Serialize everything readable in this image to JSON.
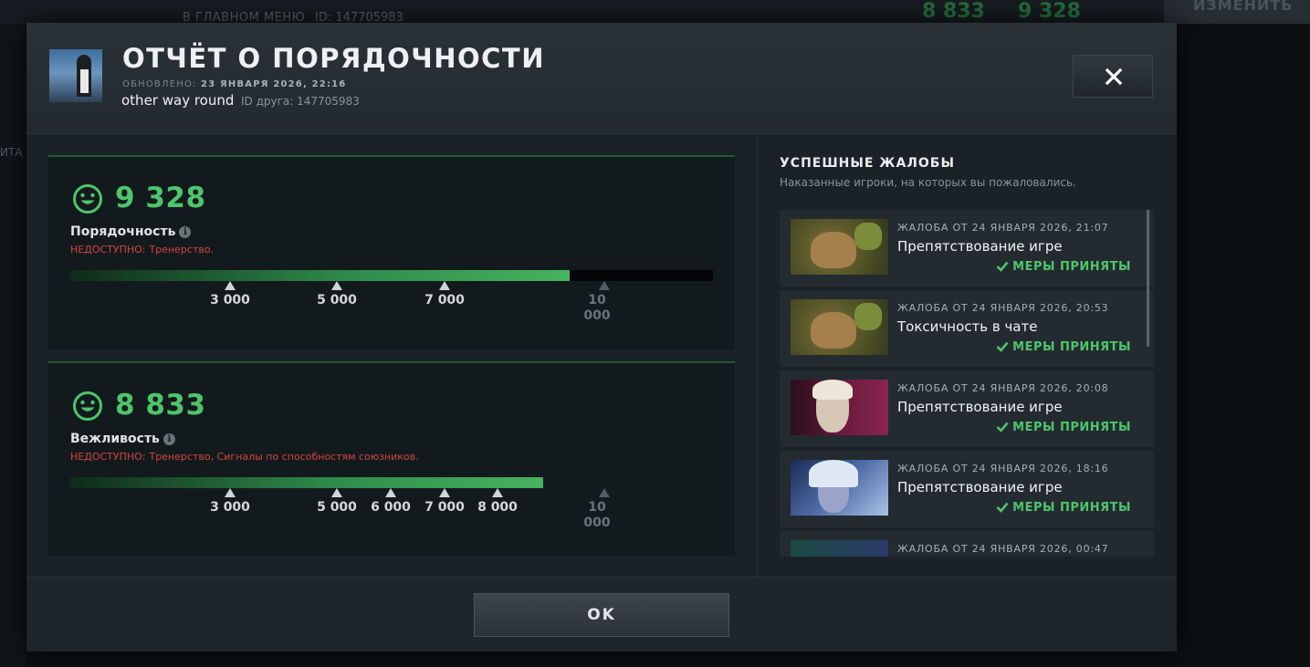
{
  "background": {
    "subtitle": "В ГЛАВНОМ МЕНЮ",
    "id_text": "ID: 147705983",
    "score_courtesy": "8 833",
    "score_conduct": "9 328",
    "change_label": "ИЗМЕНИТЬ",
    "side_label": "ИТА"
  },
  "header": {
    "title": "ОТЧЁТ О ПОРЯДОЧНОСТИ",
    "updated_label": "ОБНОВЛЕНО:",
    "updated_value": "23 ЯНВАРЯ 2026, 22:16",
    "username": "other way round",
    "friend_id": "ID друга: 147705983"
  },
  "conduct": {
    "score": "9 328",
    "label": "Порядочность",
    "unavailable_label": "НЕДОСТУПНО:",
    "unavailable_items": "Тренерство.",
    "fill_value": 9328,
    "max_value": 12000,
    "ticks": [
      "3 000",
      "5 000",
      "7 000"
    ],
    "tick_dim_1": "10",
    "tick_dim_2": "000"
  },
  "courtesy": {
    "score": "8 833",
    "label": "Вежливость",
    "unavailable_label": "НЕДОСТУПНО:",
    "unavailable_items": "Тренерство, Сигналы по способностям союзников.",
    "fill_value": 8833,
    "max_value": 12000,
    "ticks": [
      "3 000",
      "5 000",
      "6 000",
      "7 000",
      "8 000"
    ],
    "tick_dim_1": "10",
    "tick_dim_2": "000"
  },
  "reports_panel": {
    "title": "УСПЕШНЫЕ ЖАЛОБЫ",
    "subtitle": "Наказанные игроки, на которых вы пожаловались.",
    "items": [
      {
        "date": "ЖАЛОБА ОТ 24 ЯНВАРЯ 2026, 21:07",
        "reason": "Препятствование игре",
        "status": "МЕРЫ ПРИНЯТЫ",
        "hero": "pudge"
      },
      {
        "date": "ЖАЛОБА ОТ 24 ЯНВАРЯ 2026, 20:53",
        "reason": "Токсичность в чате",
        "status": "МЕРЫ ПРИНЯТЫ",
        "hero": "pudge"
      },
      {
        "date": "ЖАЛОБА ОТ 24 ЯНВАРЯ 2026, 20:08",
        "reason": "Препятствование игре",
        "status": "МЕРЫ ПРИНЯТЫ",
        "hero": "invoker"
      },
      {
        "date": "ЖАЛОБА ОТ 24 ЯНВАРЯ 2026, 18:16",
        "reason": "Препятствование игре",
        "status": "МЕРЫ ПРИНЯТЫ",
        "hero": "drow-ranger"
      },
      {
        "date": "ЖАЛОБА ОТ 24 ЯНВАРЯ 2026, 00:47",
        "reason": "",
        "status": "",
        "hero": "unknown"
      }
    ]
  },
  "footer": {
    "ok_label": "OK"
  },
  "colors": {
    "accent_green": "#4ec56b",
    "warning_red": "#d2463d",
    "modal_bg": "#1b2227"
  }
}
